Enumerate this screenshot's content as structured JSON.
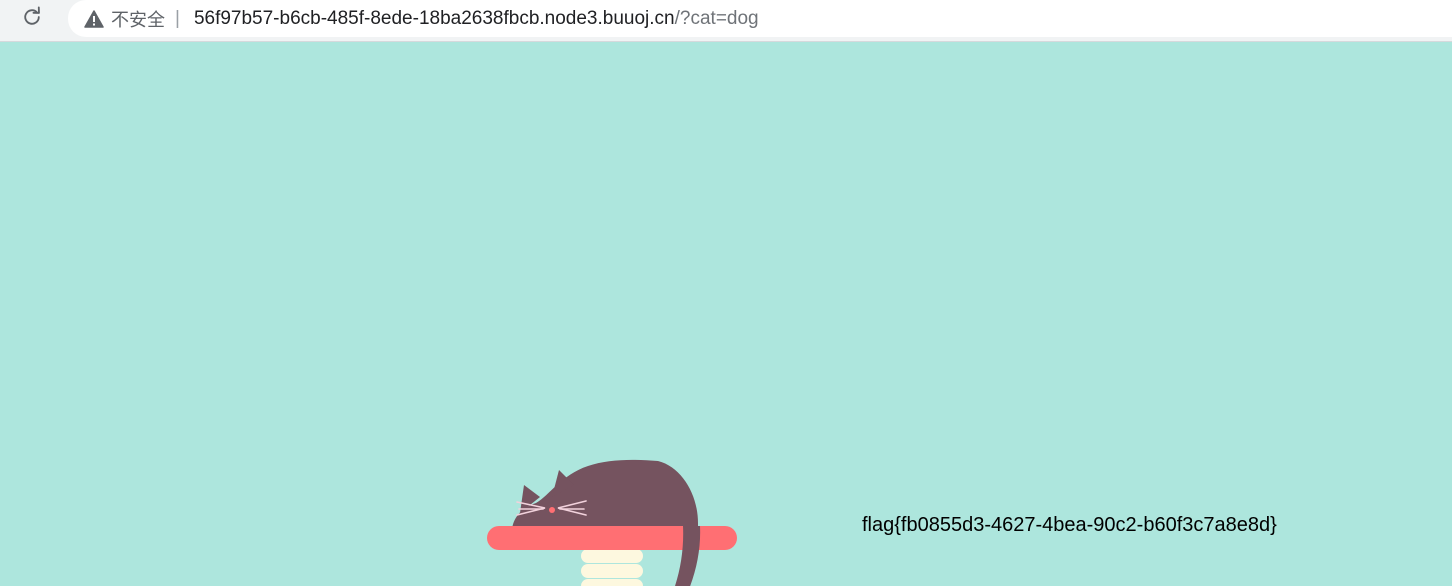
{
  "browser": {
    "security_label": "不安全",
    "separator": "|",
    "url_host": "56f97b57-b6cb-485f-8ede-18ba2638fbcb.node3.buuoj.cn",
    "url_path": "/?cat=dog"
  },
  "page": {
    "flag_text": "flag{fb0855d3-4627-4bea-90c2-b60f3c7a8e8d}"
  },
  "colors": {
    "background": "#ade6dd",
    "cat": "#75535f",
    "perch": "#ff6f73",
    "post": "#fdf8df"
  }
}
